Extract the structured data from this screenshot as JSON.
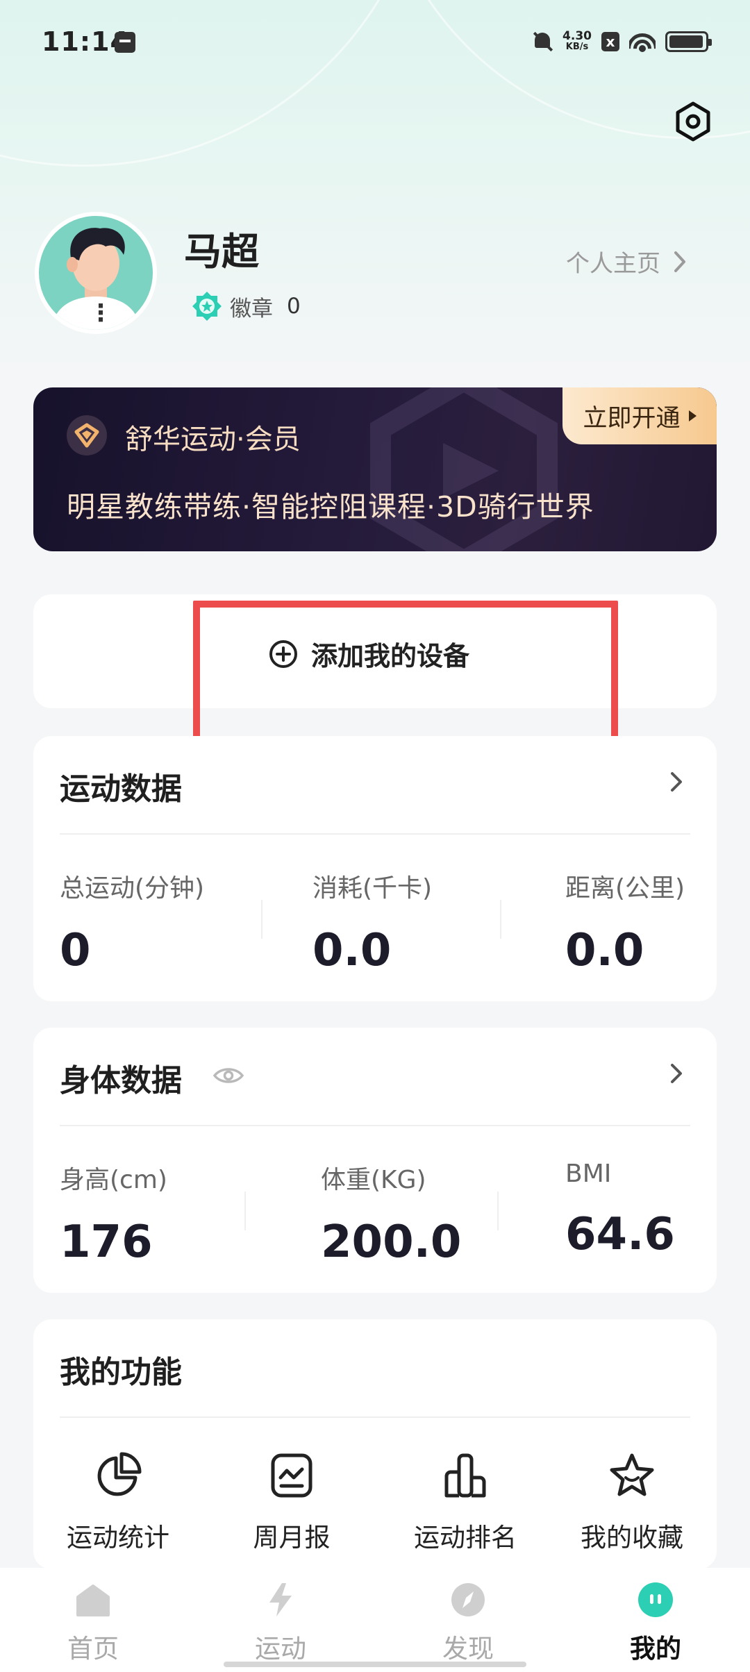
{
  "status_bar": {
    "time": "11:14",
    "net_speed_value": "4.30",
    "net_speed_unit": "KB/s",
    "sim_badge": "x",
    "icons": [
      "calendar-icon",
      "bell-mute-icon",
      "wifi-icon",
      "battery-icon"
    ]
  },
  "header": {
    "settings_icon": "settings-hex-icon"
  },
  "profile": {
    "name": "马超",
    "badge_label": "徽章",
    "badge_count": "0",
    "homepage_link": "个人主页",
    "avatar_menu_glyph": "⋮"
  },
  "member_banner": {
    "title": "舒华运动·会员",
    "description": "明星教练带练·智能控阻课程·3D骑行世界",
    "cta": "立即开通"
  },
  "device": {
    "add_label": "添加我的设备"
  },
  "sports_data": {
    "title": "运动数据",
    "stats": [
      {
        "label": "总运动(分钟)",
        "value": "0"
      },
      {
        "label": "消耗(千卡)",
        "value": "0.0"
      },
      {
        "label": "距离(公里)",
        "value": "0.0"
      }
    ]
  },
  "body_data": {
    "title": "身体数据",
    "stats": [
      {
        "label": "身高(cm)",
        "value": "176"
      },
      {
        "label": "体重(KG)",
        "value": "200.0"
      },
      {
        "label": "BMI",
        "value": "64.6"
      }
    ]
  },
  "functions": {
    "title": "我的功能",
    "items": [
      {
        "label": "运动统计",
        "icon": "pie-chart-icon"
      },
      {
        "label": "周月报",
        "icon": "report-icon"
      },
      {
        "label": "运动排名",
        "icon": "ranking-icon"
      },
      {
        "label": "我的收藏",
        "icon": "star-icon"
      }
    ]
  },
  "bottom_nav": {
    "items": [
      {
        "label": "首页",
        "icon": "home-icon"
      },
      {
        "label": "运动",
        "icon": "lightning-icon"
      },
      {
        "label": "发现",
        "icon": "compass-icon"
      },
      {
        "label": "我的",
        "icon": "profile-face-icon"
      }
    ],
    "active": "我的"
  },
  "colors": {
    "accent_teal": "#2ccfb3",
    "highlight_red": "#ec4c4c",
    "banner_dark": "#1b1430",
    "banner_gold": "#f6c98f"
  }
}
